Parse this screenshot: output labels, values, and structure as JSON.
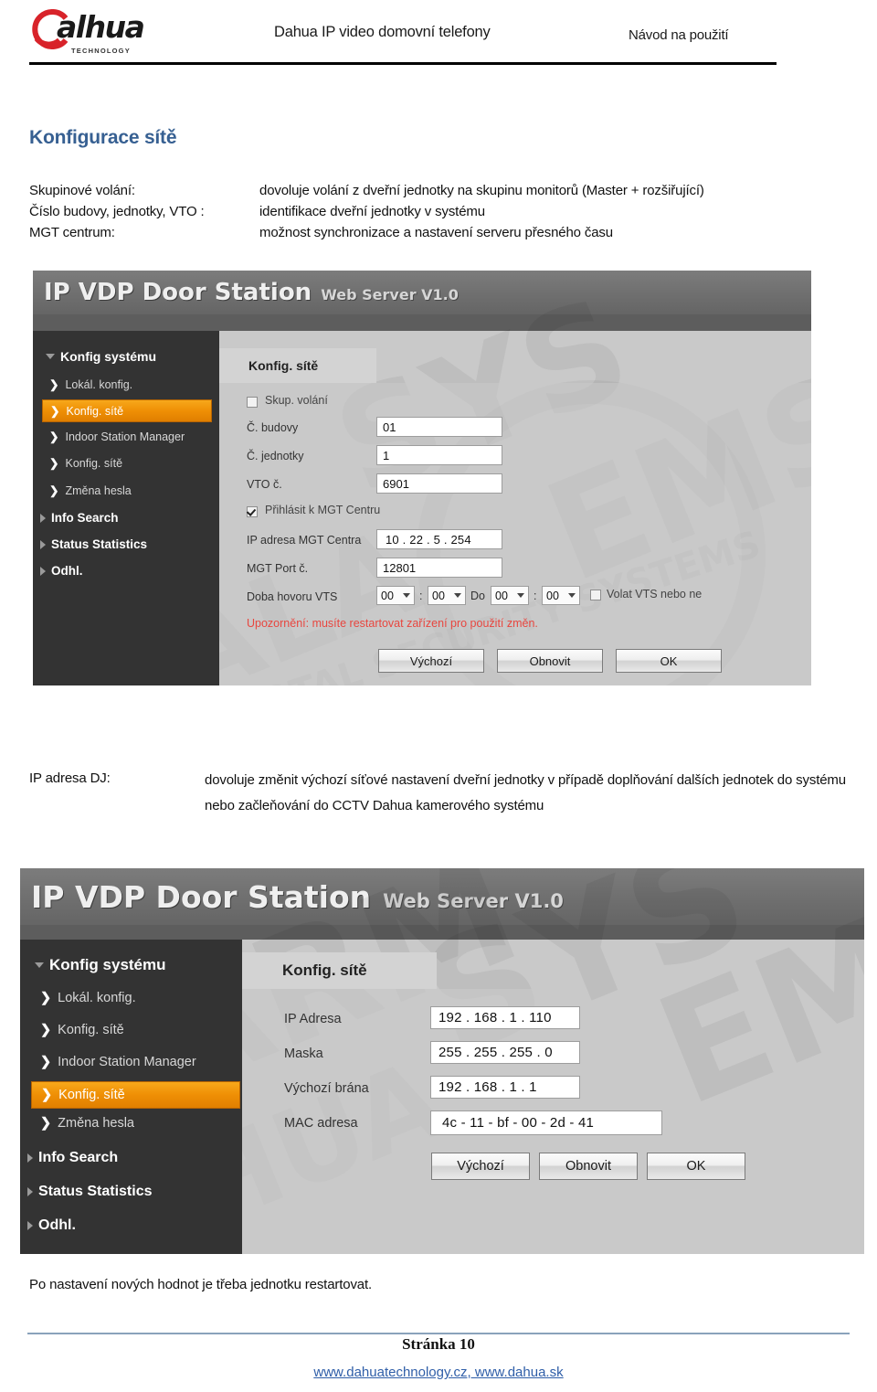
{
  "header": {
    "logo_word": "alhua",
    "logo_tagline": "TECHNOLOGY",
    "center_title": "Dahua IP video domovní telefony",
    "right_title": "Návod na použití"
  },
  "section": {
    "title": "Konfigurace sítě",
    "definitions": [
      {
        "term": "Skupinové volání:",
        "desc": "dovoluje volání z dveřní jednotky na skupinu monitorů (Master + rozšiřující)"
      },
      {
        "term": "Číslo budovy, jednotky, VTO :",
        "desc": "identifikace dveřní jednotky v systému"
      },
      {
        "term": "MGT centrum:",
        "desc": "možnost synchronizace a nastavení serveru přesného času"
      }
    ]
  },
  "shot1": {
    "title_main": "IP VDP Door Station",
    "title_sub": "Web Server V1.0",
    "sidebar": {
      "group": "Konfig systému",
      "items": [
        {
          "label": "Lokál. konfig.",
          "selected": false
        },
        {
          "label": "Konfig. sítě",
          "selected": true
        },
        {
          "label": "Indoor Station Manager",
          "selected": false
        },
        {
          "label": "Konfig. sítě",
          "selected": false
        },
        {
          "label": "Změna hesla",
          "selected": false
        }
      ],
      "groups_bottom": [
        "Info Search",
        "Status Statistics",
        "Odhl."
      ]
    },
    "tab_label": "Konfig. sítě",
    "group_call": {
      "label": "Skup. volání",
      "checked": false
    },
    "fields": [
      {
        "label": "Č. budovy",
        "value": "01"
      },
      {
        "label": "Č. jednotky",
        "value": "1"
      },
      {
        "label": "VTO č.",
        "value": "6901"
      }
    ],
    "mgt_checkbox": {
      "label": "Přihlásit k MGT Centru",
      "checked": true
    },
    "mgt_ip": {
      "label": "IP adresa MGT Centra",
      "value": "10 .  22 .  5  .  254"
    },
    "mgt_port": {
      "label": "MGT Port č.",
      "value": "12801"
    },
    "vts": {
      "label": "Doba hovoru VTS",
      "from_hour": "00",
      "from_min": "00",
      "to_word": "Do",
      "to_hour": "00",
      "to_min": "00",
      "colon": ":",
      "checkbox_label": "Volat VTS nebo ne",
      "checkbox_checked": false
    },
    "warning": "Upozornění: musíte restartovat zařízení pro použití změn.",
    "buttons": [
      "Výchozí",
      "Obnovit",
      "OK"
    ]
  },
  "middle": {
    "term": "IP adresa DJ:",
    "desc": "dovoluje změnit výchozí síťové nastavení dveřní jednotky v případě doplňování dalších jednotek do systému nebo začleňování do CCTV Dahua kamerového systému"
  },
  "shot2": {
    "title_main": "IP VDP Door Station",
    "title_sub": "Web Server V1.0",
    "sidebar": {
      "group": "Konfig systému",
      "items": [
        {
          "label": "Lokál. konfig.",
          "selected": false
        },
        {
          "label": "Konfig. sítě",
          "selected": false
        },
        {
          "label": "Indoor Station Manager",
          "selected": false
        },
        {
          "label": "Konfig. sítě",
          "selected": true
        },
        {
          "label": "Změna hesla",
          "selected": false
        }
      ],
      "groups_bottom": [
        "Info Search",
        "Status Statistics",
        "Odhl."
      ]
    },
    "tab_label": "Konfig. sítě",
    "fields": [
      {
        "label": "IP Adresa",
        "value": "192 .  168 .   1   .  110"
      },
      {
        "label": "Maska",
        "value": "255 .  255 .  255 .    0"
      },
      {
        "label": "Výchozí brána",
        "value": "192 .  168 .   1   .    1"
      },
      {
        "label": "MAC adresa",
        "value": "4c  -  11  -  bf  -  00  -  2d  -  41"
      }
    ],
    "buttons": [
      "Výchozí",
      "Obnovit",
      "OK"
    ]
  },
  "footer": {
    "note": "Po nastavení nových hodnot je třeba jednotku restartovat.",
    "page": "Stránka 10",
    "links": "www.dahuatechnology.cz, www.dahua.sk"
  },
  "colors": {
    "heading": "#376092",
    "accent_orange": "#ef8f05",
    "warning_red": "#e8463f",
    "link_blue": "#2f5ea8"
  }
}
